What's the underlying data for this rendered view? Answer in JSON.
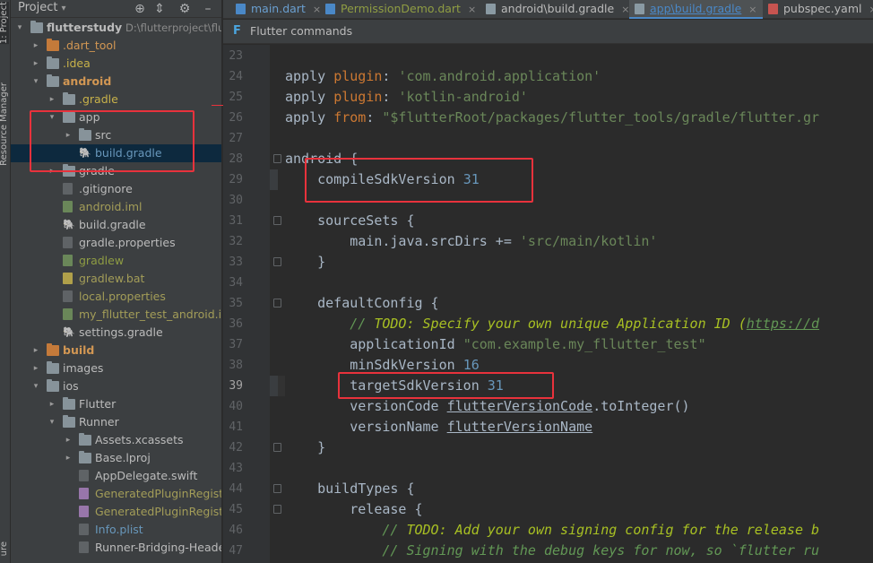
{
  "sidebar": {
    "labels": [
      "1: Project",
      "Resource Manager",
      "ure"
    ]
  },
  "project_panel": {
    "title": "Project",
    "caret": "▾",
    "toolbar_icons": [
      {
        "name": "locate-icon",
        "glyph": "⊕"
      },
      {
        "name": "collapse-icon",
        "glyph": "⇕"
      },
      {
        "name": "gear-icon",
        "glyph": "⚙"
      },
      {
        "name": "hide-icon",
        "glyph": "–"
      }
    ],
    "tree": [
      {
        "indent": 0,
        "arrow": "▾",
        "icon": "folder",
        "label": "flutterstudy",
        "extra": "D:\\flutterproject\\flutters",
        "style": "c-bold"
      },
      {
        "indent": 1,
        "arrow": "▸",
        "icon": "folder-orange",
        "label": ".dart_tool",
        "style": "c-orange"
      },
      {
        "indent": 1,
        "arrow": "▸",
        "icon": "folder",
        "label": ".idea",
        "style": "c-yellowish"
      },
      {
        "indent": 1,
        "arrow": "▾",
        "icon": "folder",
        "label": "android",
        "style": "c-boldorange"
      },
      {
        "indent": 2,
        "arrow": "▸",
        "icon": "folder",
        "label": ".gradle",
        "style": "c-yellowish"
      },
      {
        "indent": 2,
        "arrow": "▾",
        "icon": "folder",
        "label": "app",
        "style": "c-normal"
      },
      {
        "indent": 3,
        "arrow": "▸",
        "icon": "folder",
        "label": "src",
        "style": "c-normal"
      },
      {
        "indent": 3,
        "arrow": "",
        "icon": "elephant",
        "label": "build.gradle",
        "style": "c-blue",
        "selected": true
      },
      {
        "indent": 2,
        "arrow": "▸",
        "icon": "folder",
        "label": "gradle",
        "style": "c-normal"
      },
      {
        "indent": 2,
        "arrow": "",
        "icon": "file",
        "label": ".gitignore",
        "style": "c-normal"
      },
      {
        "indent": 2,
        "arrow": "",
        "icon": "file-green",
        "label": "android.iml",
        "style": "c-olive"
      },
      {
        "indent": 2,
        "arrow": "",
        "icon": "elephant",
        "label": "build.gradle",
        "style": "c-normal"
      },
      {
        "indent": 2,
        "arrow": "",
        "icon": "file",
        "label": "gradle.properties",
        "style": "c-normal"
      },
      {
        "indent": 2,
        "arrow": "",
        "icon": "file-green",
        "label": "gradlew",
        "style": "c-green"
      },
      {
        "indent": 2,
        "arrow": "",
        "icon": "file-yellow",
        "label": "gradlew.bat",
        "style": "c-olive"
      },
      {
        "indent": 2,
        "arrow": "",
        "icon": "file",
        "label": "local.properties",
        "style": "c-olive"
      },
      {
        "indent": 2,
        "arrow": "",
        "icon": "file-green",
        "label": "my_fllutter_test_android.iml",
        "style": "c-olive"
      },
      {
        "indent": 2,
        "arrow": "",
        "icon": "elephant",
        "label": "settings.gradle",
        "style": "c-normal"
      },
      {
        "indent": 1,
        "arrow": "▸",
        "icon": "folder-orange",
        "label": "build",
        "style": "c-boldorange"
      },
      {
        "indent": 1,
        "arrow": "▸",
        "icon": "folder",
        "label": "images",
        "style": "c-normal"
      },
      {
        "indent": 1,
        "arrow": "▾",
        "icon": "folder",
        "label": "ios",
        "style": "c-normal"
      },
      {
        "indent": 2,
        "arrow": "▸",
        "icon": "folder",
        "label": "Flutter",
        "style": "c-normal"
      },
      {
        "indent": 2,
        "arrow": "▾",
        "icon": "folder",
        "label": "Runner",
        "style": "c-normal"
      },
      {
        "indent": 3,
        "arrow": "▸",
        "icon": "folder",
        "label": "Assets.xcassets",
        "style": "c-normal"
      },
      {
        "indent": 3,
        "arrow": "▸",
        "icon": "folder",
        "label": "Base.lproj",
        "style": "c-normal"
      },
      {
        "indent": 3,
        "arrow": "",
        "icon": "file",
        "label": "AppDelegate.swift",
        "style": "c-normal"
      },
      {
        "indent": 3,
        "arrow": "",
        "icon": "file-purple",
        "label": "GeneratedPluginRegistrant.h",
        "style": "c-olive"
      },
      {
        "indent": 3,
        "arrow": "",
        "icon": "file-purple",
        "label": "GeneratedPluginRegistrant.m",
        "style": "c-olive"
      },
      {
        "indent": 3,
        "arrow": "",
        "icon": "file",
        "label": "Info.plist",
        "style": "c-blue"
      },
      {
        "indent": 3,
        "arrow": "",
        "icon": "file",
        "label": "Runner-Bridging-Header.h",
        "style": "c-normal"
      }
    ]
  },
  "tabs": [
    {
      "label": "main.dart",
      "icon_color": "#4a88c7",
      "style": "c-dart",
      "close": "×",
      "active": false
    },
    {
      "label": "PermissionDemo.dart",
      "icon_color": "#4a88c7",
      "style": "c-green",
      "close": "×",
      "active": false
    },
    {
      "label": "android\\build.gradle",
      "icon_color": "#8a9aa3",
      "style": "",
      "close": "×",
      "active": false
    },
    {
      "label": "app\\build.gradle",
      "icon_color": "#8a9aa3",
      "style": "",
      "close": "×",
      "active": true
    },
    {
      "label": "pubspec.yaml",
      "icon_color": "#c75450",
      "style": "",
      "close": "×",
      "active": false
    }
  ],
  "flutter_bar": {
    "icon": "F",
    "label": "Flutter commands"
  },
  "editor": {
    "current_line": 39,
    "lines": [
      {
        "n": 23,
        "tokens": []
      },
      {
        "n": 24,
        "tokens": [
          [
            "tok-plain",
            "apply "
          ],
          [
            "tok-kw",
            "plugin"
          ],
          [
            "tok-plain",
            ": "
          ],
          [
            "tok-str",
            "'com.android.application'"
          ]
        ]
      },
      {
        "n": 25,
        "tokens": [
          [
            "tok-plain",
            "apply "
          ],
          [
            "tok-kw",
            "plugin"
          ],
          [
            "tok-plain",
            ": "
          ],
          [
            "tok-str",
            "'kotlin-android'"
          ]
        ]
      },
      {
        "n": 26,
        "tokens": [
          [
            "tok-plain",
            "apply "
          ],
          [
            "tok-kw",
            "from"
          ],
          [
            "tok-plain",
            ": "
          ],
          [
            "tok-str",
            "\"$flutterRoot/packages/flutter_tools/gradle/flutter.gr"
          ]
        ]
      },
      {
        "n": 27,
        "tokens": []
      },
      {
        "n": 28,
        "tokens": [
          [
            "tok-plain",
            "android {"
          ]
        ],
        "fold": true
      },
      {
        "n": 29,
        "tokens": [
          [
            "tok-plain",
            "    compileSdkVersion "
          ],
          [
            "tok-num",
            "31"
          ]
        ]
      },
      {
        "n": 30,
        "tokens": []
      },
      {
        "n": 31,
        "tokens": [
          [
            "tok-plain",
            "    sourceSets {"
          ]
        ],
        "fold": true
      },
      {
        "n": 32,
        "tokens": [
          [
            "tok-plain",
            "        main.java.srcDirs += "
          ],
          [
            "tok-str",
            "'src/main/kotlin'"
          ]
        ]
      },
      {
        "n": 33,
        "tokens": [
          [
            "tok-plain",
            "    }"
          ]
        ],
        "fold": true
      },
      {
        "n": 34,
        "tokens": []
      },
      {
        "n": 35,
        "tokens": [
          [
            "tok-plain",
            "    defaultConfig {"
          ]
        ],
        "fold": true
      },
      {
        "n": 36,
        "tokens": [
          [
            "tok-cm",
            "        // "
          ],
          [
            "tok-todo",
            "TODO: Specify your own unique Application ID ("
          ],
          [
            "tok-link",
            "https://d"
          ]
        ]
      },
      {
        "n": 37,
        "tokens": [
          [
            "tok-plain",
            "        applicationId "
          ],
          [
            "tok-str",
            "\"com.example.my_fllutter_test\""
          ]
        ]
      },
      {
        "n": 38,
        "tokens": [
          [
            "tok-plain",
            "        minSdkVersion "
          ],
          [
            "tok-num",
            "16"
          ]
        ]
      },
      {
        "n": 39,
        "tokens": [
          [
            "tok-plain",
            "        targetSdkVersion "
          ],
          [
            "tok-num",
            "31"
          ]
        ]
      },
      {
        "n": 40,
        "tokens": [
          [
            "tok-plain",
            "        versionCode "
          ],
          [
            "tok-ul",
            "flutterVersionCode"
          ],
          [
            "tok-plain",
            ".toInteger()"
          ]
        ]
      },
      {
        "n": 41,
        "tokens": [
          [
            "tok-plain",
            "        versionName "
          ],
          [
            "tok-ul",
            "flutterVersionName"
          ]
        ]
      },
      {
        "n": 42,
        "tokens": [
          [
            "tok-plain",
            "    }"
          ]
        ],
        "fold": true
      },
      {
        "n": 43,
        "tokens": []
      },
      {
        "n": 44,
        "tokens": [
          [
            "tok-plain",
            "    buildTypes {"
          ]
        ],
        "fold": true
      },
      {
        "n": 45,
        "tokens": [
          [
            "tok-plain",
            "        release {"
          ]
        ],
        "fold": true
      },
      {
        "n": 46,
        "tokens": [
          [
            "tok-cm",
            "            // "
          ],
          [
            "tok-todo",
            "TODO: Add your own signing config for the release b"
          ]
        ]
      },
      {
        "n": 47,
        "tokens": [
          [
            "tok-cm",
            "            // Signing with the debug keys for now, so `flutter ru"
          ]
        ]
      }
    ]
  },
  "colors": {
    "highlight_box": "#e8323c",
    "accent": "#4a88c7"
  }
}
